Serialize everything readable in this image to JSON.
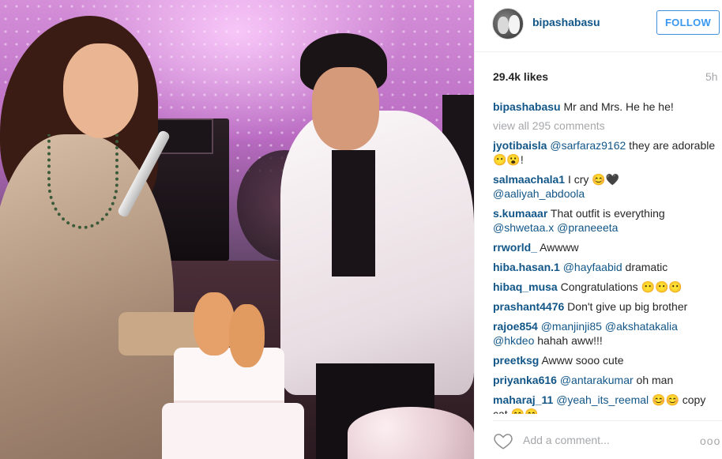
{
  "post": {
    "username": "bipashabasu",
    "follow_label": "FOLLOW",
    "likes": "29.4k likes",
    "time": "5h",
    "caption_user": "bipashabasu",
    "caption_text": "Mr and Mrs. He he he!",
    "view_all": "view all 295 comments"
  },
  "comments": [
    {
      "user": "jyotibaisla",
      "mentions": [
        "@sarfaraz9162"
      ],
      "text": " they are adorable 😶😮!"
    },
    {
      "user": "salmaachala1",
      "text": " I cry 😊🖤",
      "mentions": [
        "@aaliyah_abdoola"
      ]
    },
    {
      "user": "s.kumaaar",
      "text": " That outfit is everything",
      "mentions": [
        "@shwetaa.x",
        "@praneeeta"
      ]
    },
    {
      "user": "rrworld_",
      "text": " Awwww",
      "mentions": []
    },
    {
      "user": "hiba.hasan.1",
      "mentions": [
        "@hayfaabid"
      ],
      "text": " dramatic"
    },
    {
      "user": "hibaq_musa",
      "text": " Congratulations 😶😶😶",
      "mentions": []
    },
    {
      "user": "prashant4476",
      "text": " Don't give up big brother",
      "mentions": []
    },
    {
      "user": "rajoe854",
      "mentions": [
        "@manjinji85",
        "@akshatakalia",
        "@hkdeo"
      ],
      "text": " hahah aww!!!"
    },
    {
      "user": "preetksg",
      "text": " Awww sooo cute",
      "mentions": []
    },
    {
      "user": "priyanka616",
      "mentions": [
        "@antarakumar"
      ],
      "text": " oh man"
    },
    {
      "user": "maharaj_11",
      "mentions": [
        "@yeah_its_reemal"
      ],
      "text": " 😊😊 copy cat 😊😊"
    }
  ],
  "footer": {
    "add_comment_placeholder": "Add a comment...",
    "more_label": "ooo",
    "like_icon": "heart-outline-icon"
  },
  "colors": {
    "link": "#125688",
    "follow": "#3897f0",
    "muted": "#a5a7aa",
    "text": "#262626"
  }
}
